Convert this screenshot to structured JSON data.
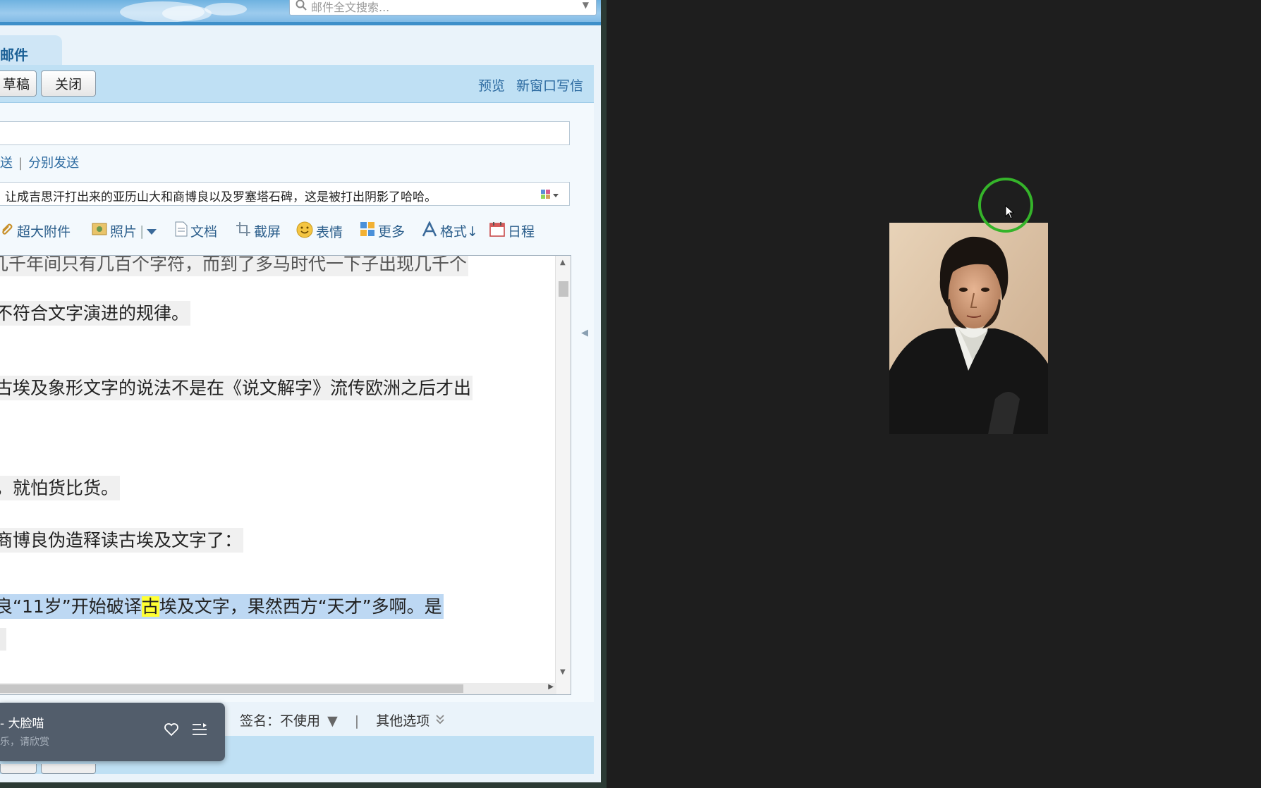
{
  "search": {
    "placeholder": "邮件全文搜索..."
  },
  "tab": {
    "label": "邮件"
  },
  "toolbar": {
    "draft_label": "草稿",
    "close_label": "关闭",
    "preview_label": "预览",
    "new_window_label": "新窗口写信"
  },
  "send_options": {
    "send": "发送",
    "separate_send": "分别发送"
  },
  "subject": {
    "value": "让成吉思汗打出来的亚历山大和商博良以及罗塞塔石碑，这是被打出阴影了哈哈。"
  },
  "attachments": {
    "items": [
      {
        "label": "超大附件"
      },
      {
        "label": "照片"
      },
      {
        "label": "文档"
      },
      {
        "label": "截屏"
      },
      {
        "label": "表情"
      },
      {
        "label": "更多"
      },
      {
        "label": "格式↓"
      },
      {
        "label": "日程"
      }
    ]
  },
  "editor": {
    "lines": [
      "几千年间只有几百个字符，而到了多马时代一下子出现几千个",
      "不符合文字演进的规律。",
      "古埃及象形文字的说法不是在《说文解字》流传欧洲之后才出",
      "，就怕货比货。",
      "商博良伪造释读古埃及文字了："
    ],
    "selected_before": "良“11岁”开始破译",
    "selected_highlight": "古",
    "selected_after": "埃及文字，果然西方“天才”多啊。是"
  },
  "footer": {
    "signature_label": "签名：",
    "signature_value": "不使用",
    "other_options": "其他选项"
  },
  "music": {
    "title": "- 大脸喵",
    "subtitle": "乐，请欣赏"
  },
  "colors": {
    "accent": "#2c6aa0",
    "toolbar_bg": "#bfe0f4",
    "cursor_ring": "#35b42a",
    "highlight": "#ffff33"
  }
}
